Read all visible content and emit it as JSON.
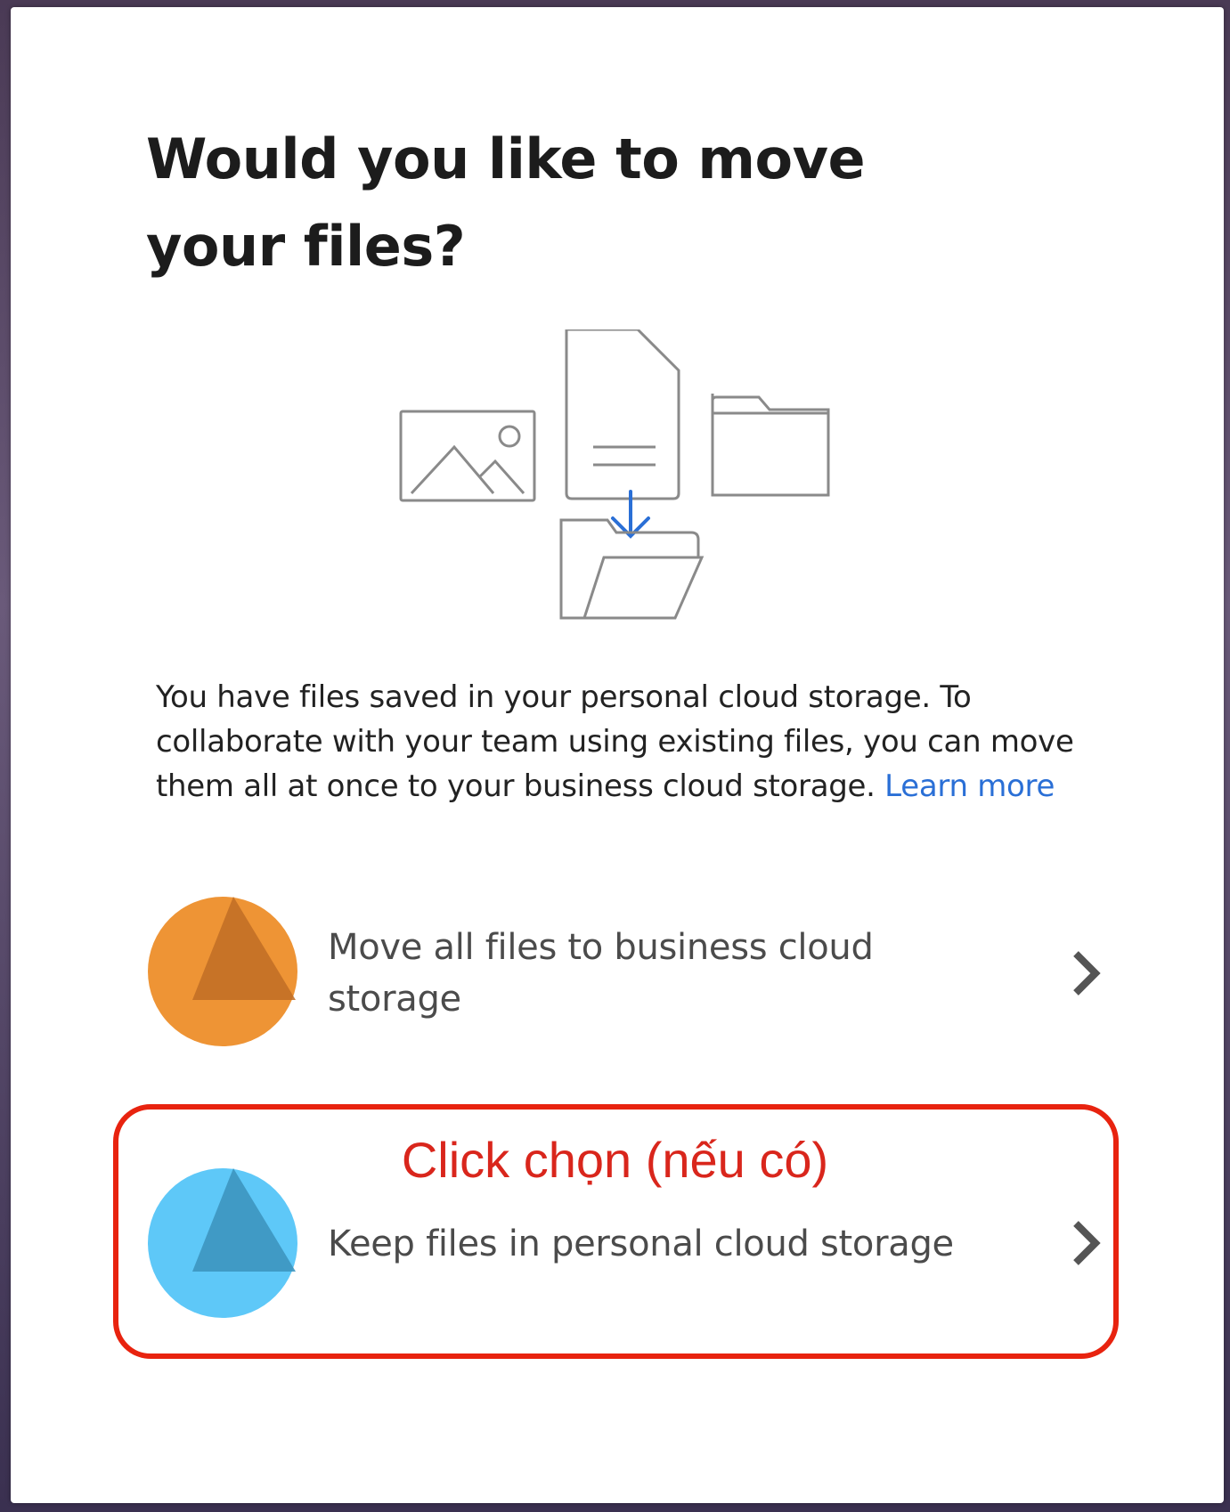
{
  "dialog": {
    "title": "Would you like to move your files?",
    "description": "You have files saved in your personal cloud storage. To collaborate with your team using existing files, you can move them all at once to your business cloud storage.",
    "learn_more": "Learn more"
  },
  "options": [
    {
      "label": "Move all files to business cloud storage",
      "icon": "cloud-storage-icon",
      "color": "#ee9435"
    },
    {
      "label": "Keep files in personal cloud storage",
      "icon": "cloud-storage-icon",
      "color": "#5ec8f8"
    }
  ],
  "annotation": {
    "text": "Click chọn (nếu có)",
    "color": "#e8230f"
  },
  "illustration": {
    "icons": [
      "image-icon",
      "document-icon",
      "folder-icon",
      "download-arrow-icon",
      "open-folder-icon"
    ],
    "accent_color": "#2a6fd6"
  }
}
